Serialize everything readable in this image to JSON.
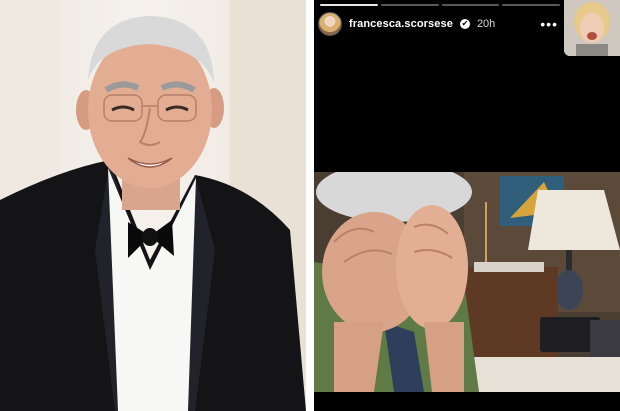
{
  "story": {
    "username": "francesca.scorsese",
    "time_ago": "20h",
    "progress_segments": 4,
    "active_segment": 1,
    "verified_symbol": "✔",
    "more_symbol": "•••",
    "icons": {
      "avatar": "profile-avatar",
      "verified": "verified-badge-icon",
      "more": "more-options-icon"
    }
  },
  "colors": {
    "story_background": "#000000",
    "page_background": "#ffffff",
    "tux": "#141416",
    "sweater": "#5f7a46"
  }
}
